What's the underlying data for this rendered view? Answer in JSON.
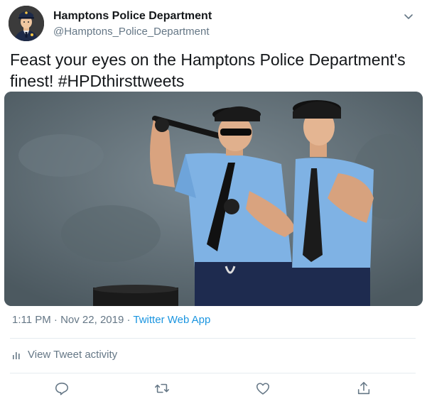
{
  "tweet": {
    "author_name": "Hamptons Police Department",
    "author_handle": "@Hamptons_Police_Department",
    "text_main": "Feast your eyes on the Hamptons Police Department's finest! ",
    "hashtag": "#HPDthirsttweets",
    "time": "1:11 PM",
    "separator_1": " · ",
    "date": "Nov 22, 2019",
    "separator_2": " · ",
    "source": "Twitter Web App",
    "activity_label": "View Tweet activity"
  },
  "icons": {
    "avatar": "police-officer-avatar",
    "caret": "chevron-down-icon",
    "activity": "bar-chart-icon",
    "reply": "reply-icon",
    "retweet": "retweet-icon",
    "like": "heart-icon",
    "share": "share-icon"
  },
  "colors": {
    "text": "#14171a",
    "secondary": "#657786",
    "link": "#1b95e0",
    "divider": "#e6ecf0"
  }
}
